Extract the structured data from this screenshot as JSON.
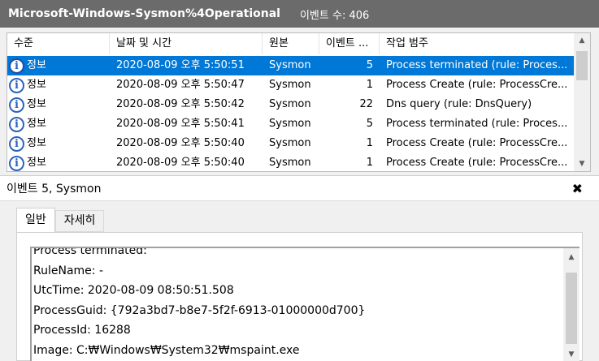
{
  "window": {
    "log_name": "Microsoft-Windows-Sysmon%4Operational",
    "event_count": "이벤트 수: 406"
  },
  "columns": [
    "수준",
    "날짜 및 시간",
    "원본",
    "이벤트 ...",
    "작업 범주"
  ],
  "events": [
    {
      "level": "정보",
      "datetime": "2020-08-09 오후 5:50:51",
      "source": "Sysmon",
      "event_id": "5",
      "task": "Process terminated (rule: Proces...",
      "selected": true
    },
    {
      "level": "정보",
      "datetime": "2020-08-09 오후 5:50:47",
      "source": "Sysmon",
      "event_id": "1",
      "task": "Process Create (rule: ProcessCre...",
      "selected": false
    },
    {
      "level": "정보",
      "datetime": "2020-08-09 오후 5:50:42",
      "source": "Sysmon",
      "event_id": "22",
      "task": "Dns query (rule: DnsQuery)",
      "selected": false
    },
    {
      "level": "정보",
      "datetime": "2020-08-09 오후 5:50:41",
      "source": "Sysmon",
      "event_id": "5",
      "task": "Process terminated (rule: Proces...",
      "selected": false
    },
    {
      "level": "정보",
      "datetime": "2020-08-09 오후 5:50:40",
      "source": "Sysmon",
      "event_id": "1",
      "task": "Process Create (rule: ProcessCre...",
      "selected": false
    },
    {
      "level": "정보",
      "datetime": "2020-08-09 오후 5:50:40",
      "source": "Sysmon",
      "event_id": "1",
      "task": "Process Create (rule: ProcessCre...",
      "selected": false
    }
  ],
  "detail": {
    "title": "이벤트 5, Sysmon",
    "close_label": "✖",
    "tabs": [
      {
        "label": "일반",
        "active": true
      },
      {
        "label": "자세히",
        "active": false
      }
    ],
    "lines": [
      "Process terminated:",
      "RuleName: -",
      "UtcTime: 2020-08-09 08:50:51.508",
      "ProcessGuid: {792a3bd7-b8e7-5f2f-6913-01000000d700}",
      "ProcessId: 16288",
      "Image: C:₩Windows₩System32₩mspaint.exe"
    ]
  },
  "icons": {
    "info": "info-icon",
    "scroll_up": "▲",
    "scroll_down": "▼"
  },
  "colors": {
    "selection": "#0078d7",
    "titlebar": "#6b6b6b"
  }
}
